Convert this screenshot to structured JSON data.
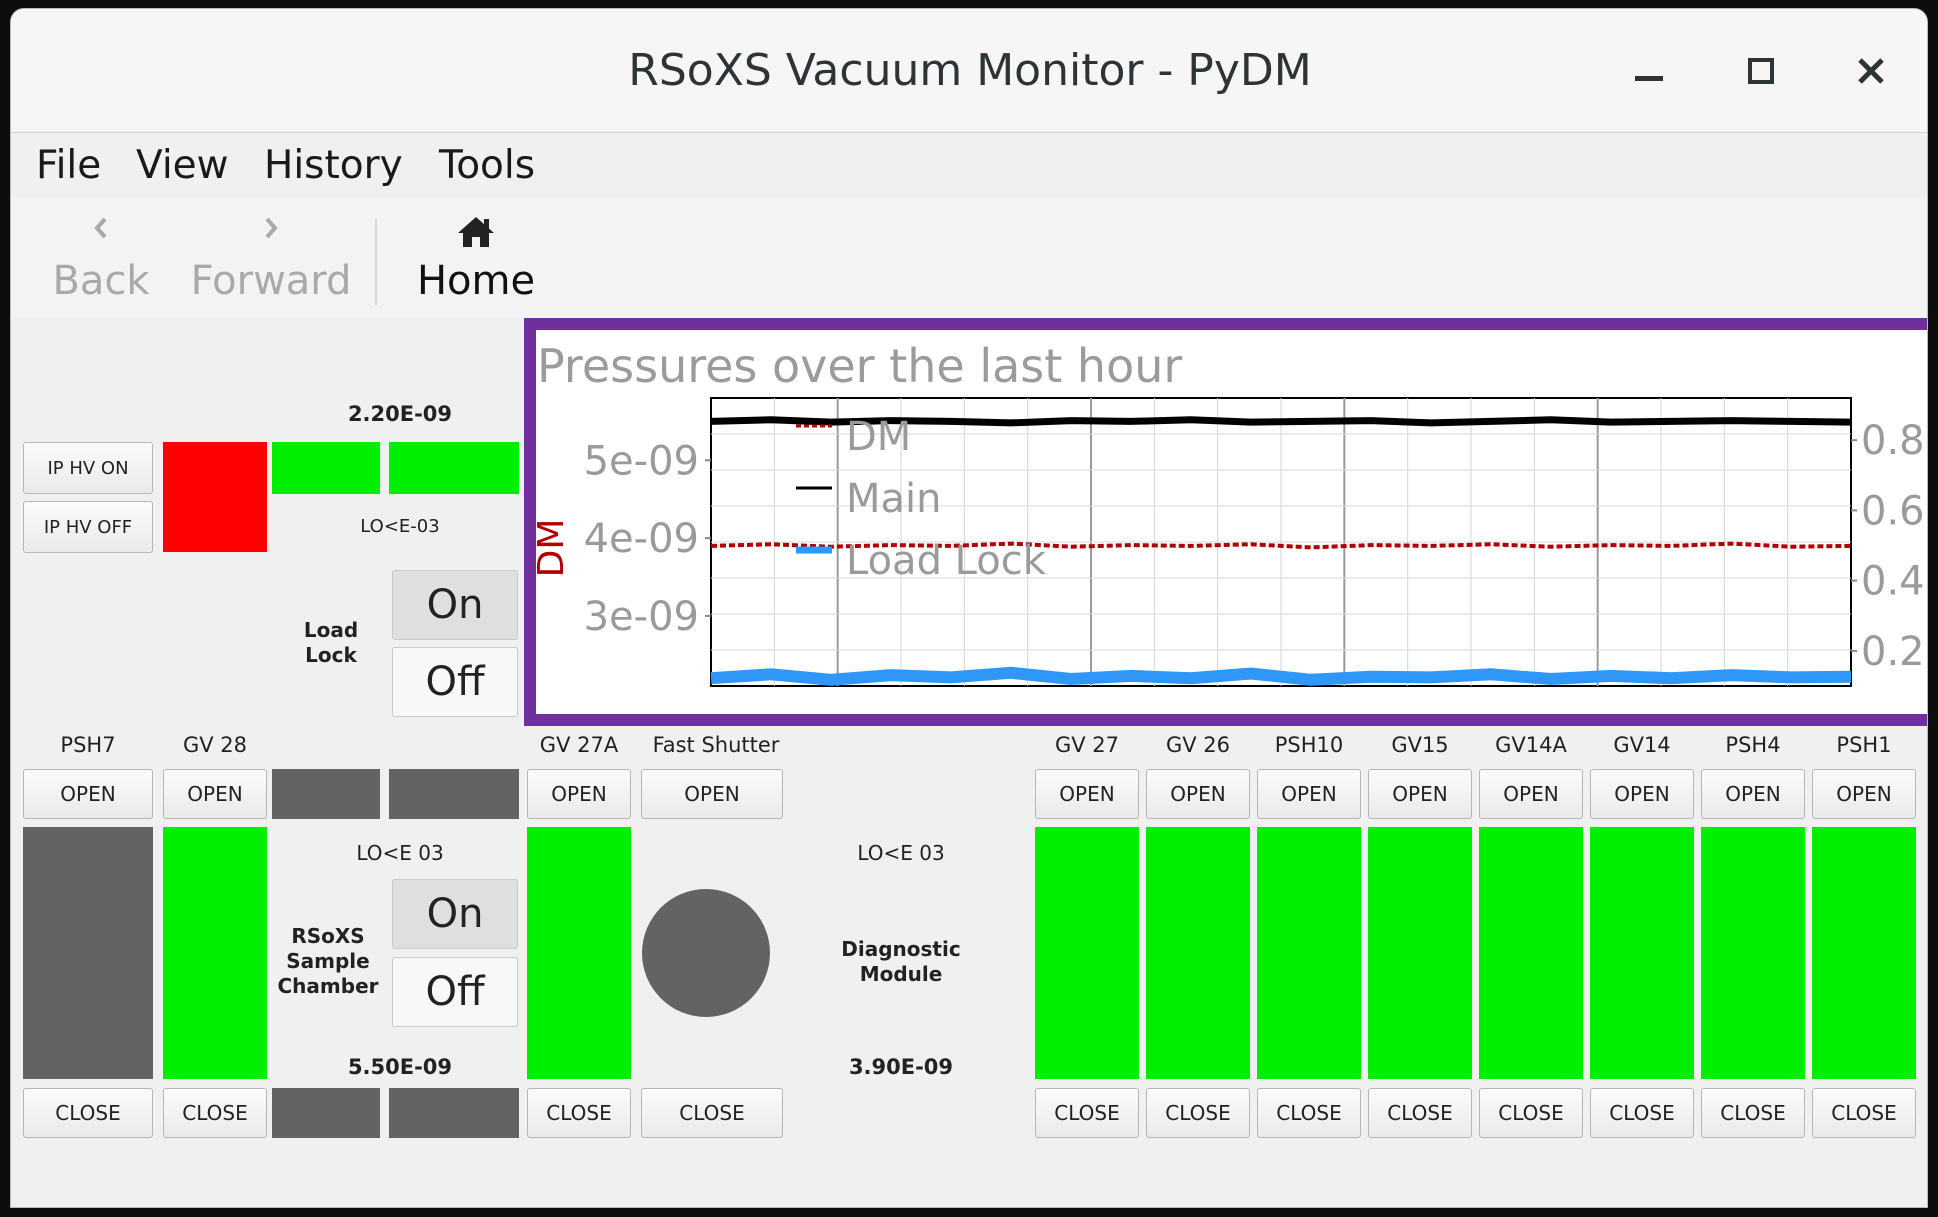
{
  "window": {
    "title": "RSoXS Vacuum Monitor - PyDM"
  },
  "menu": [
    "File",
    "View",
    "History",
    "Tools"
  ],
  "toolbar": {
    "back_label": "Back",
    "forward_label": "Forward",
    "home_label": "Home"
  },
  "top_panel": {
    "ip_hv_on": "IP HV ON",
    "ip_hv_off": "IP HV OFF",
    "gauge_value": "2.20E-09",
    "gauge_status": "LO<E-03",
    "section_label": "Load\nLock",
    "on_label": "On",
    "off_label": "Off"
  },
  "valves_left": [
    {
      "name": "PSH7",
      "open": "OPEN",
      "close": "CLOSE"
    },
    {
      "name": "GV 28",
      "open": "OPEN",
      "close": "CLOSE"
    }
  ],
  "rsoxs": {
    "status": "LO<E 03",
    "label": "RSoXS\nSample\nChamber",
    "on_label": "On",
    "off_label": "Off",
    "value": "5.50E-09"
  },
  "valves_mid": [
    {
      "name": "GV 27A",
      "open": "OPEN",
      "close": "CLOSE"
    },
    {
      "name": "Fast Shutter",
      "open": "OPEN",
      "close": "CLOSE"
    }
  ],
  "diagnostic": {
    "status": "LO<E 03",
    "label": "Diagnostic\nModule",
    "value": "3.90E-09"
  },
  "valves_right": [
    {
      "name": "GV 27",
      "open": "OPEN",
      "close": "CLOSE"
    },
    {
      "name": "GV 26",
      "open": "OPEN",
      "close": "CLOSE"
    },
    {
      "name": "PSH10",
      "open": "OPEN",
      "close": "CLOSE"
    },
    {
      "name": "GV15",
      "open": "OPEN",
      "close": "CLOSE"
    },
    {
      "name": "GV14A",
      "open": "OPEN",
      "close": "CLOSE"
    },
    {
      "name": "GV14",
      "open": "OPEN",
      "close": "CLOSE"
    },
    {
      "name": "PSH4",
      "open": "OPEN",
      "close": "CLOSE"
    },
    {
      "name": "PSH1",
      "open": "OPEN",
      "close": "CLOSE"
    }
  ],
  "colors": {
    "green": "#00ee00",
    "red": "#ff0000",
    "gray": "#626462",
    "highlight": "#6f2f9c",
    "dm": "#b00000",
    "main": "#000000",
    "loadlock": "#2f97f7"
  },
  "chart_data": {
    "type": "line",
    "title": "Pressures over the last hour",
    "ylabel": "DM",
    "ylim": [
      2.1e-09,
      5.8e-09
    ],
    "y_ticks": [
      "5e-09",
      "4e-09",
      "3e-09"
    ],
    "y_tick_values": [
      5e-09,
      4e-09,
      3e-09
    ],
    "y2lim": [
      0.1,
      0.92
    ],
    "y2_ticks": [
      "0.8",
      "0.6",
      "0.4",
      "0.2"
    ],
    "y2_tick_values": [
      0.8,
      0.6,
      0.4,
      0.2
    ],
    "grid": true,
    "legend_position": "upper-left",
    "series": [
      {
        "name": "DM",
        "color": "#b00000",
        "style": "dotted",
        "axis": "left",
        "values": [
          3.9e-09,
          3.92e-09,
          3.89e-09,
          3.91e-09,
          3.9e-09,
          3.93e-09,
          3.89e-09,
          3.91e-09,
          3.9e-09,
          3.92e-09,
          3.88e-09,
          3.91e-09,
          3.9e-09,
          3.92e-09,
          3.89e-09,
          3.91e-09,
          3.9e-09,
          3.93e-09,
          3.89e-09,
          3.9e-09
        ]
      },
      {
        "name": "Main",
        "color": "#000000",
        "style": "solid",
        "axis": "left",
        "values": [
          5.5e-09,
          5.52e-09,
          5.49e-09,
          5.51e-09,
          5.5e-09,
          5.48e-09,
          5.51e-09,
          5.5e-09,
          5.52e-09,
          5.49e-09,
          5.5e-09,
          5.51e-09,
          5.48e-09,
          5.5e-09,
          5.52e-09,
          5.49e-09,
          5.5e-09,
          5.51e-09,
          5.5e-09,
          5.49e-09
        ]
      },
      {
        "name": "Load Lock",
        "color": "#2f97f7",
        "style": "solid",
        "axis": "left",
        "values": [
          2.2e-09,
          2.25e-09,
          2.18e-09,
          2.24e-09,
          2.21e-09,
          2.27e-09,
          2.19e-09,
          2.23e-09,
          2.2e-09,
          2.26e-09,
          2.18e-09,
          2.22e-09,
          2.21e-09,
          2.25e-09,
          2.19e-09,
          2.23e-09,
          2.2e-09,
          2.24e-09,
          2.21e-09,
          2.22e-09
        ]
      }
    ]
  }
}
